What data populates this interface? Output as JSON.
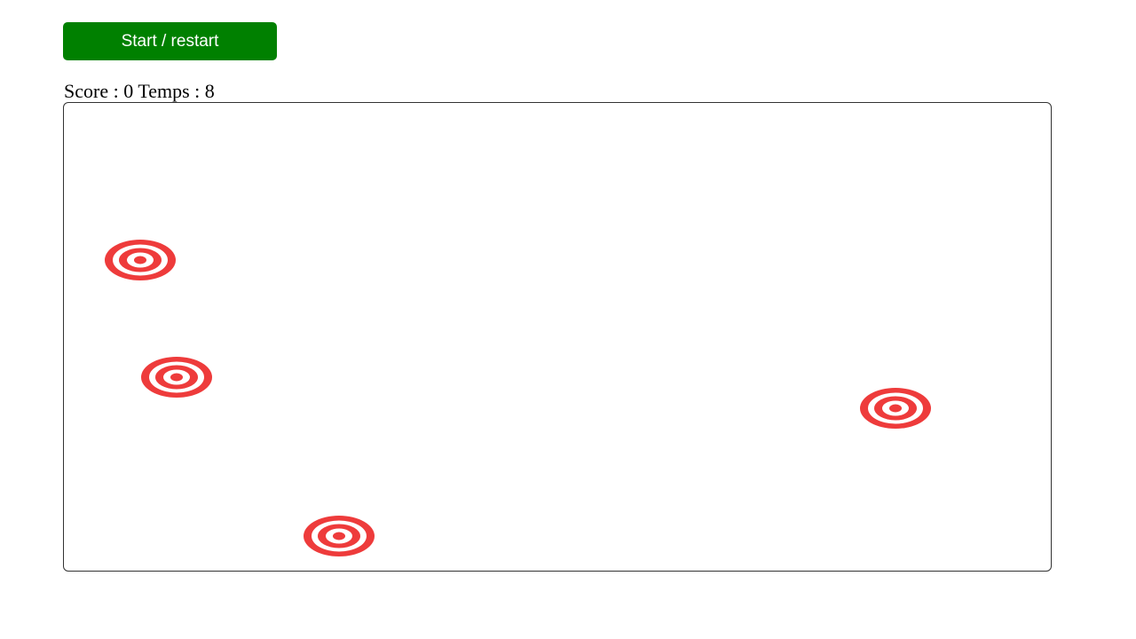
{
  "controls": {
    "start_label": "Start / restart"
  },
  "status": {
    "score_label": "Score :",
    "score_value": "0",
    "time_label": "Temps :",
    "time_value": "8"
  },
  "colors": {
    "button_green": "#008000",
    "target_red": "#ee3b3b"
  },
  "targets": [
    {
      "icon": "target-icon"
    },
    {
      "icon": "target-icon"
    },
    {
      "icon": "target-icon"
    },
    {
      "icon": "target-icon"
    }
  ]
}
